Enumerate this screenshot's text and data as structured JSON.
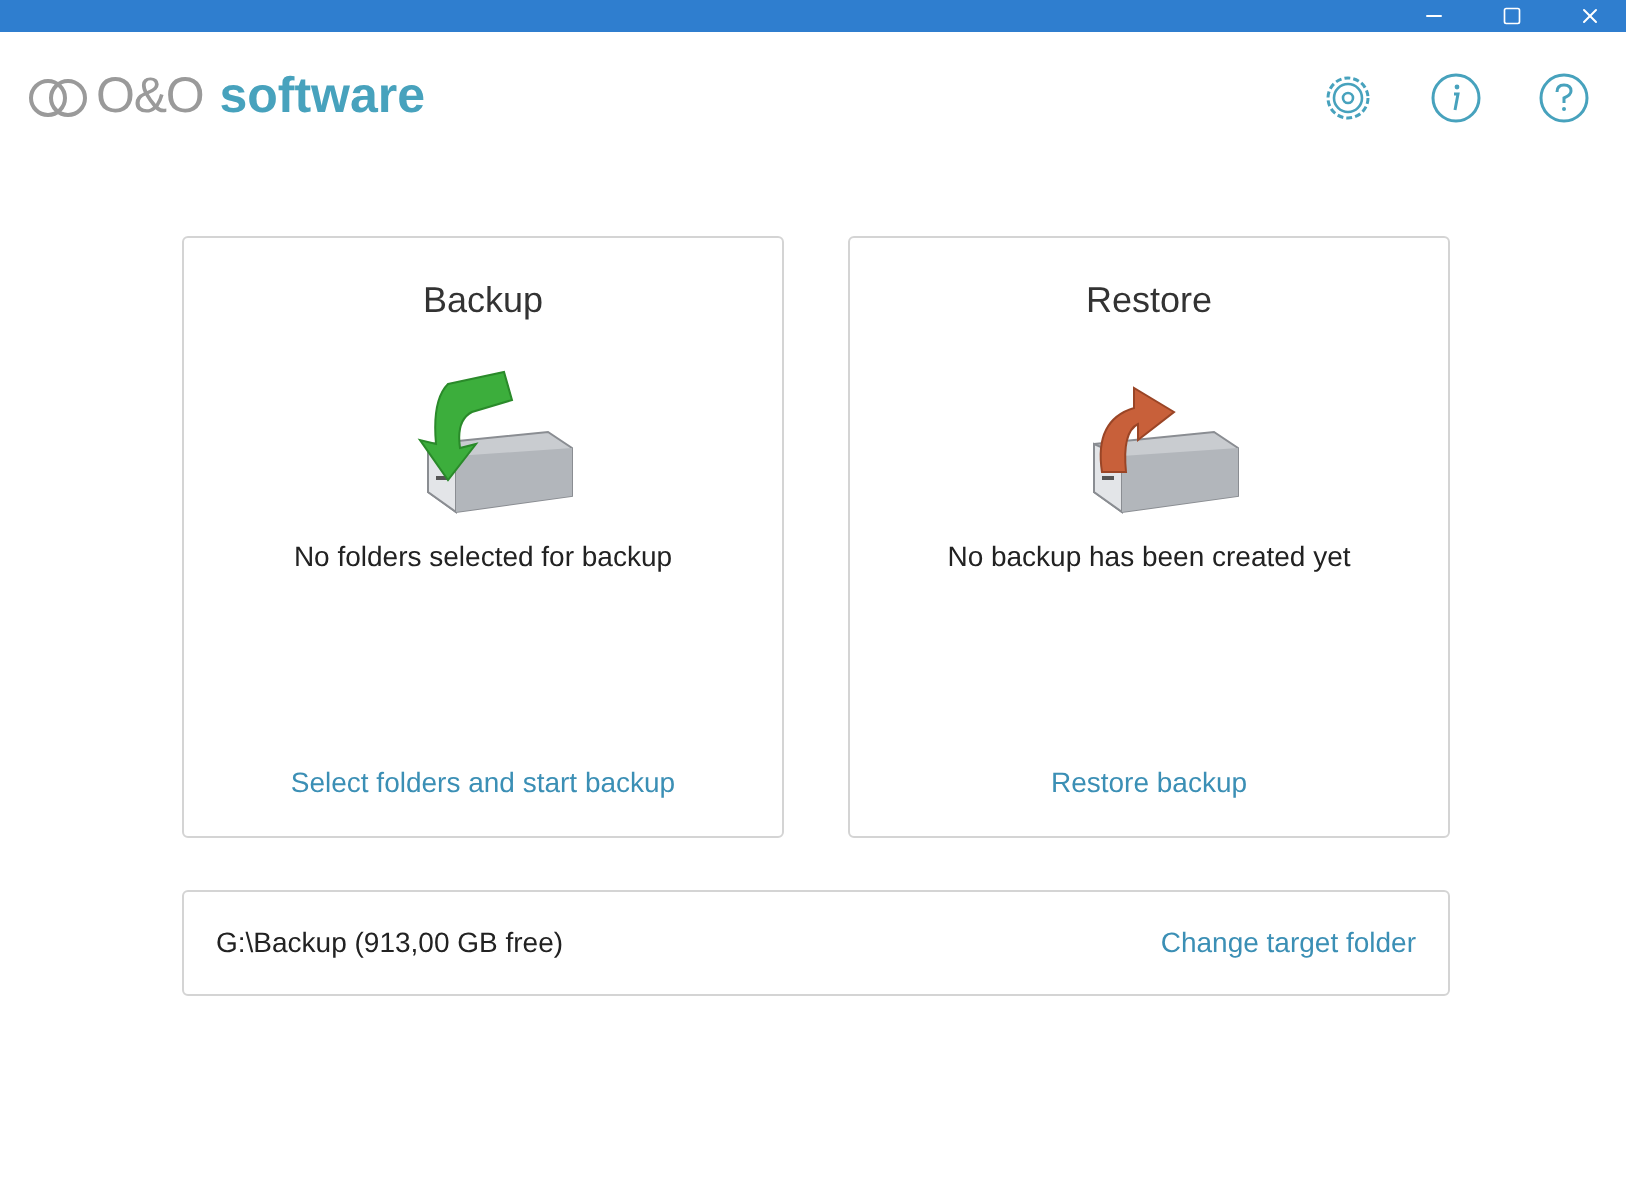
{
  "header": {
    "logo_brand": "O&O",
    "logo_word": "software"
  },
  "cards": [
    {
      "kind": "backup",
      "title": "Backup",
      "message": "No folders selected for backup",
      "link": "Select folders and start backup"
    },
    {
      "kind": "restore",
      "title": "Restore",
      "message": "No backup has been created yet",
      "link": "Restore backup"
    }
  ],
  "target": {
    "path": "G:\\Backup (913,00 GB free)",
    "link": "Change target folder"
  }
}
